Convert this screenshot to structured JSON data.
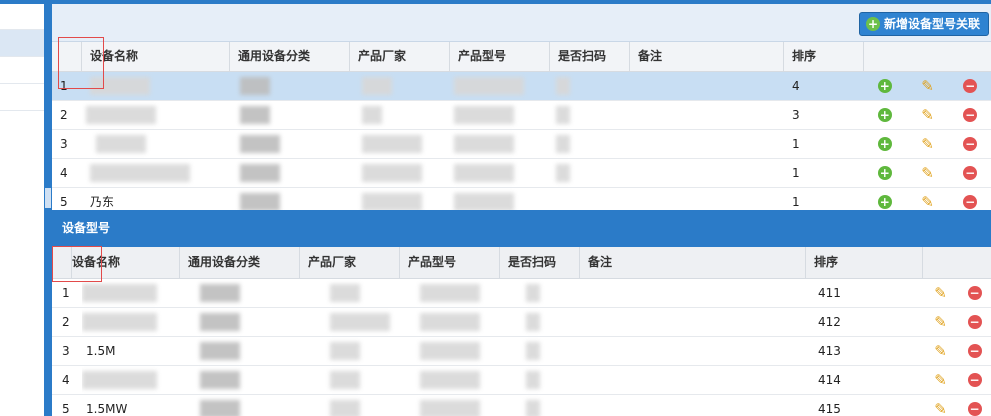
{
  "top_panel": {
    "add_button_label": "新增设备型号关联",
    "columns": [
      "设备名称",
      "通用设备分类",
      "产品厂家",
      "产品型号",
      "是否扫码",
      "备注",
      "排序"
    ],
    "rows": [
      {
        "num": "1",
        "name": "",
        "cat": "",
        "vendor": "",
        "model": "",
        "scan": "",
        "note": "",
        "sort": "4"
      },
      {
        "num": "2",
        "name": "",
        "cat": "",
        "vendor": "",
        "model": "",
        "scan": "",
        "note": "",
        "sort": "3"
      },
      {
        "num": "3",
        "name": "",
        "cat": "",
        "vendor": "",
        "model": "",
        "scan": "",
        "note": "",
        "sort": "1"
      },
      {
        "num": "4",
        "name": "",
        "cat": "",
        "vendor": "",
        "model": "",
        "scan": "",
        "note": "",
        "sort": "1"
      },
      {
        "num": "5",
        "name": "乃东",
        "cat": "",
        "vendor": "",
        "model": "",
        "scan": "",
        "note": "",
        "sort": "1"
      }
    ]
  },
  "bottom_panel": {
    "title": "设备型号",
    "columns": [
      "设备名称",
      "通用设备分类",
      "产品厂家",
      "产品型号",
      "是否扫码",
      "备注",
      "排序"
    ],
    "rows": [
      {
        "num": "1",
        "name": "",
        "sort": "411"
      },
      {
        "num": "2",
        "name": "",
        "sort": "412"
      },
      {
        "num": "3",
        "name": "1.5M",
        "sort": "413"
      },
      {
        "num": "4",
        "name": "",
        "sort": "414"
      },
      {
        "num": "5",
        "name": "1.5MW",
        "sort": "415"
      }
    ]
  },
  "icons": {
    "add": "add-circle-icon",
    "edit": "pencil-icon",
    "delete": "minus-circle-icon"
  },
  "colors": {
    "accent": "#2b7bc8",
    "selected_row": "#c8def3"
  }
}
